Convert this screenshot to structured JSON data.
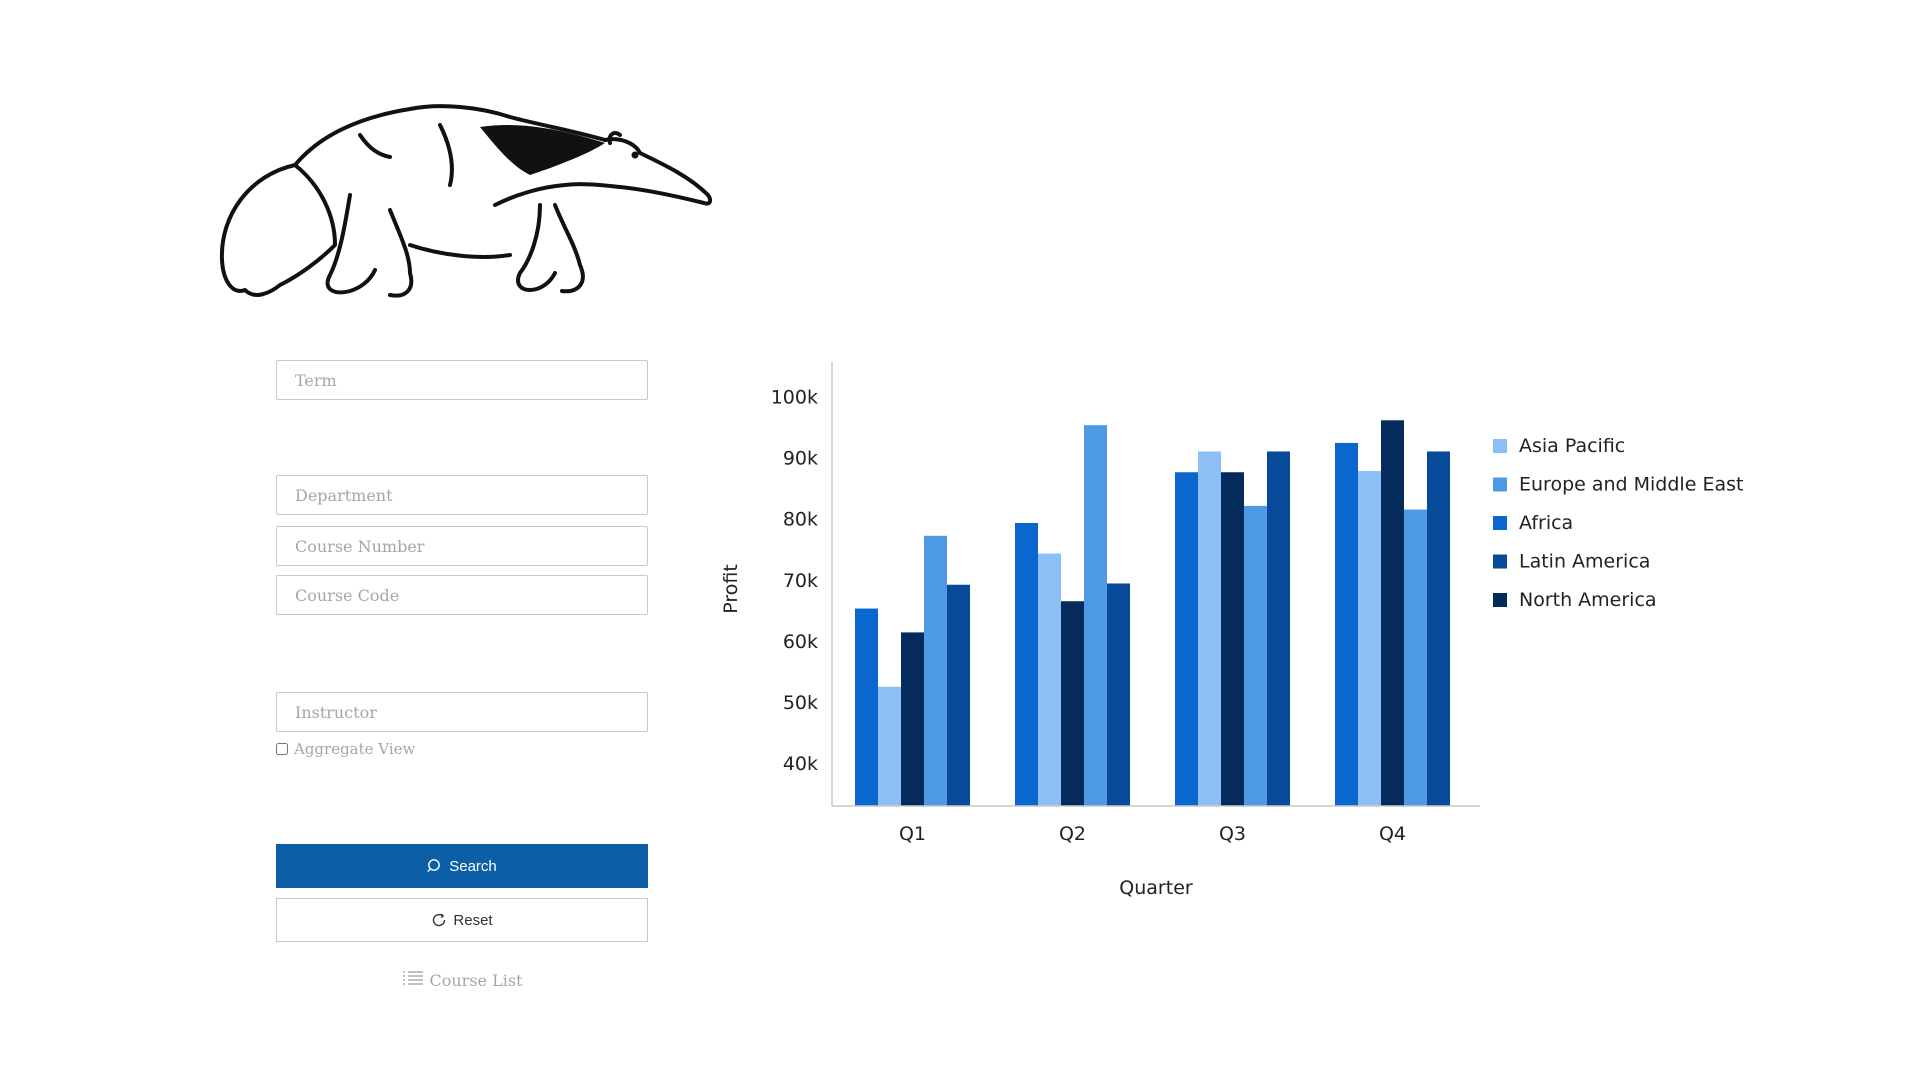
{
  "form": {
    "term_placeholder": "Term",
    "department_placeholder": "Department",
    "course_number_placeholder": "Course Number",
    "course_code_placeholder": "Course Code",
    "instructor_placeholder": "Instructor",
    "aggregate_label": "Aggregate View",
    "aggregate_checked": false,
    "search_label": "Search",
    "reset_label": "Reset",
    "course_list_label": "Course List"
  },
  "colors": {
    "primary_button": "#0c5ea6",
    "Asia Pacific": "#8bbff5",
    "Europe and Middle East": "#4e9ae6",
    "Africa": "#0a67cf",
    "Latin America": "#064a99",
    "North America": "#052b5c"
  },
  "icons": {
    "logo": "anteater-logo",
    "search": "search-icon",
    "reset": "refresh-icon",
    "course_list": "list-icon"
  },
  "chart_data": {
    "type": "bar",
    "title": "",
    "xlabel": "Quarter",
    "ylabel": "Profit",
    "categories": [
      "Q1",
      "Q2",
      "Q3",
      "Q4"
    ],
    "y_ticks": [
      "40k",
      "50k",
      "60k",
      "70k",
      "80k",
      "90k",
      "100k"
    ],
    "ylim": [
      33000,
      104000
    ],
    "grid": false,
    "legend": "right",
    "bar_order": [
      "Africa",
      "Asia Pacific",
      "North America",
      "Europe and Middle East",
      "Latin America"
    ],
    "series": [
      {
        "name": "Asia Pacific",
        "values": [
          52500,
          74300,
          91000,
          87800
        ]
      },
      {
        "name": "Europe and Middle East",
        "values": [
          77200,
          95300,
          82100,
          81500
        ]
      },
      {
        "name": "Africa",
        "values": [
          65300,
          79300,
          87600,
          92400
        ]
      },
      {
        "name": "Latin America",
        "values": [
          69200,
          69400,
          91000,
          91000
        ]
      },
      {
        "name": "North America",
        "values": [
          61400,
          66500,
          87600,
          96100
        ]
      }
    ]
  }
}
